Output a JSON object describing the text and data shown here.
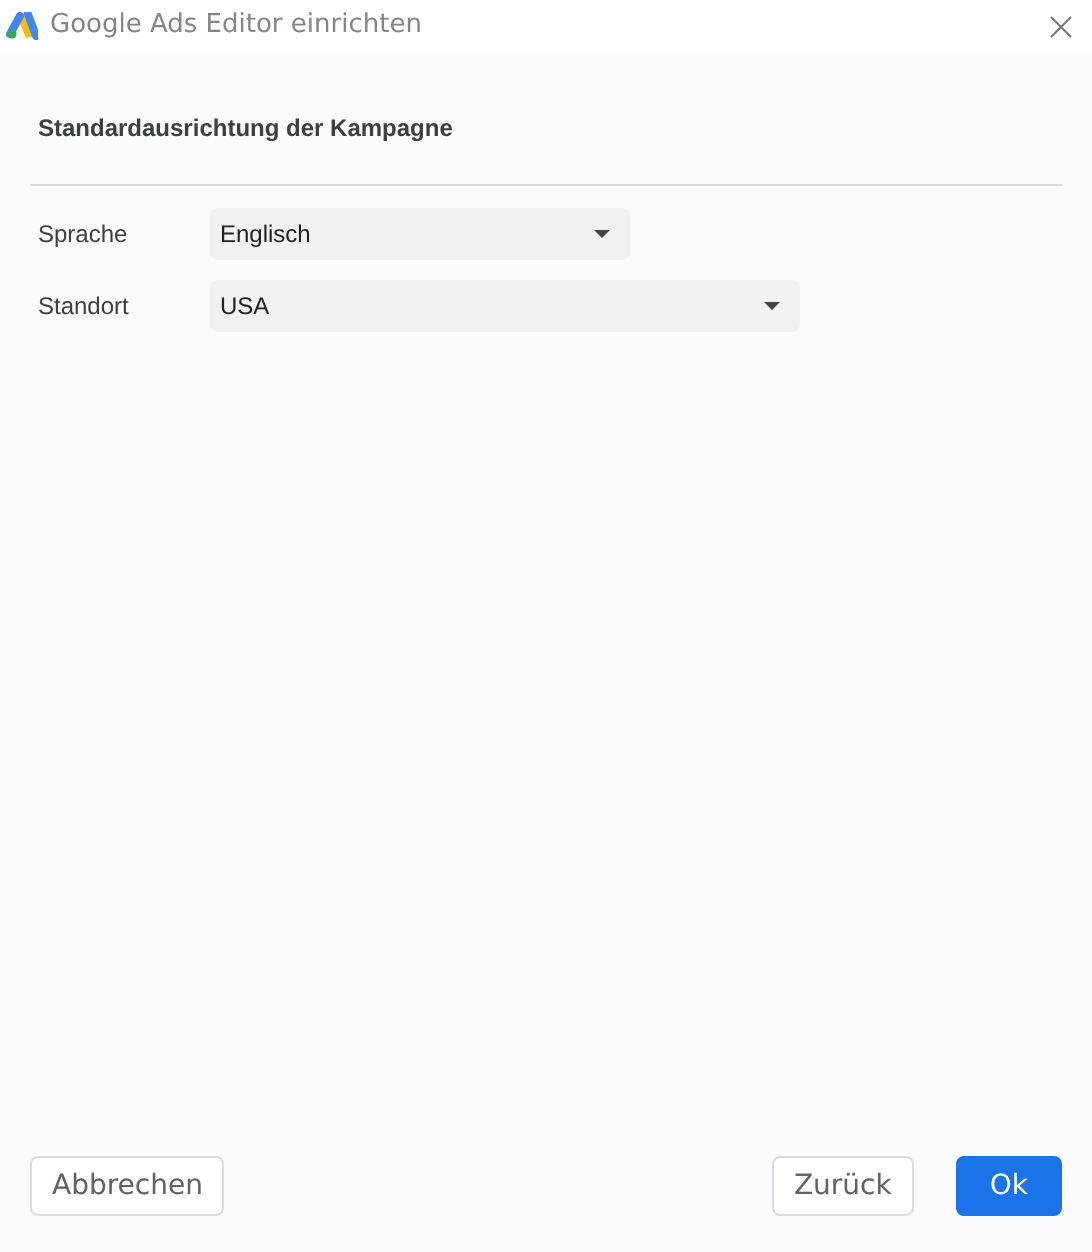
{
  "window": {
    "title": "Google Ads Editor einrichten"
  },
  "section": {
    "heading": "Standardausrichtung der Kampagne"
  },
  "fields": [
    {
      "label": "Sprache",
      "value": "Englisch"
    },
    {
      "label": "Standort",
      "value": "USA"
    }
  ],
  "buttons": [
    {
      "label": "Abbrechen",
      "kind": "secondary"
    },
    {
      "label": "Zurück",
      "kind": "secondary"
    },
    {
      "label": "Ok",
      "kind": "primary"
    }
  ]
}
